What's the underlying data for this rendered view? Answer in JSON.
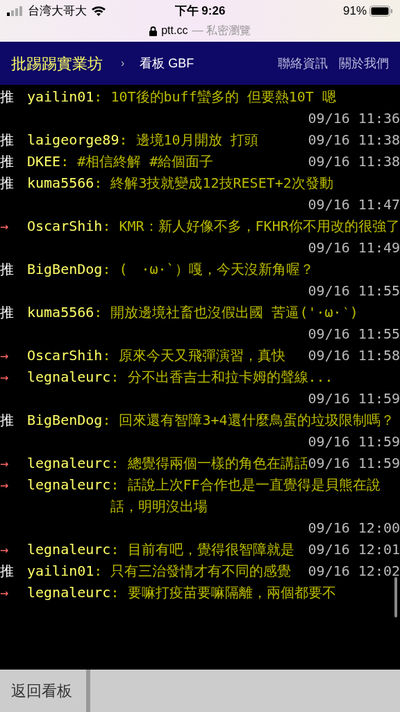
{
  "status_bar": {
    "carrier": "台湾大哥大",
    "time": "下午 9:26",
    "battery": "91%",
    "url": "ptt.cc",
    "url_note": "— 私密瀏覽"
  },
  "header": {
    "site": "批踢踢實業坊",
    "separator": "›",
    "board": "看板 GBF",
    "links": [
      "聯絡資訊",
      "關於我們"
    ]
  },
  "comments": [
    {
      "kind": "push",
      "tag": "推",
      "user": "yailin01",
      "content": ": 10T後的buff蠻多的 但要熱10T 嗯",
      "time": "09/16 11:36"
    },
    {
      "kind": "push",
      "tag": "推",
      "user": "laigeorge89",
      "content": ": 邊境10月開放 打頭",
      "time": "09/16 11:38"
    },
    {
      "kind": "push",
      "tag": "推",
      "user": "DKEE",
      "content": ": #相信終解 #給個面子",
      "time": "09/16 11:38"
    },
    {
      "kind": "push",
      "tag": "推",
      "user": "kuma5566",
      "content": ": 終解3技就變成12技RESET+2次發動",
      "time": "09/16 11:47"
    },
    {
      "kind": "arrow",
      "tag": "→",
      "user": "OscarShih",
      "content": ": KMR：新人好像不多，FKHR你不用改的很強了",
      "time": "09/16 11:49"
    },
    {
      "kind": "push",
      "tag": "推",
      "user": "BigBenDog",
      "content": ": (　·ω·`）嘎，今天沒新角喔？",
      "time": "09/16 11:55"
    },
    {
      "kind": "push",
      "tag": "推",
      "user": "kuma5566",
      "content": ": 開放邊境社畜也沒假出國 苦逼('·ω·‵)",
      "time": "09/16 11:55"
    },
    {
      "kind": "arrow",
      "tag": "→",
      "user": "OscarShih",
      "content": ": 原來今天又飛彈演習，真快",
      "time": "09/16 11:58"
    },
    {
      "kind": "arrow",
      "tag": "→",
      "user": "legnaleurc",
      "content": ": 分不出香吉士和拉卡姆的聲線...",
      "time": "09/16 11:59"
    },
    {
      "kind": "push",
      "tag": "推",
      "user": "BigBenDog",
      "content": ": 回來還有智障3+4還什麼鳥蛋的垃圾限制嗎？",
      "time": "09/16 11:59"
    },
    {
      "kind": "arrow",
      "tag": "→",
      "user": "legnaleurc",
      "content": ": 總覺得兩個一樣的角色在講話",
      "time": "09/16 11:59"
    },
    {
      "kind": "arrow",
      "tag": "→",
      "user": "legnaleurc",
      "content": ": 話說上次FF合作也是一直覺得是貝熊在說話，明明沒出場",
      "time": "09/16 12:00"
    },
    {
      "kind": "arrow",
      "tag": "→",
      "user": "legnaleurc",
      "content": ": 目前有吧，覺得很智障就是",
      "time": "09/16 12:01"
    },
    {
      "kind": "push",
      "tag": "推",
      "user": "yailin01",
      "content": ": 只有三治發情才有不同的感覺",
      "time": "09/16 12:02"
    },
    {
      "kind": "arrow",
      "tag": "→",
      "user": "legnaleurc",
      "content": ": 要嘛打疫苗要嘛隔離，兩個都要不"
    }
  ],
  "footer": {
    "back_button": "返回看板"
  }
}
